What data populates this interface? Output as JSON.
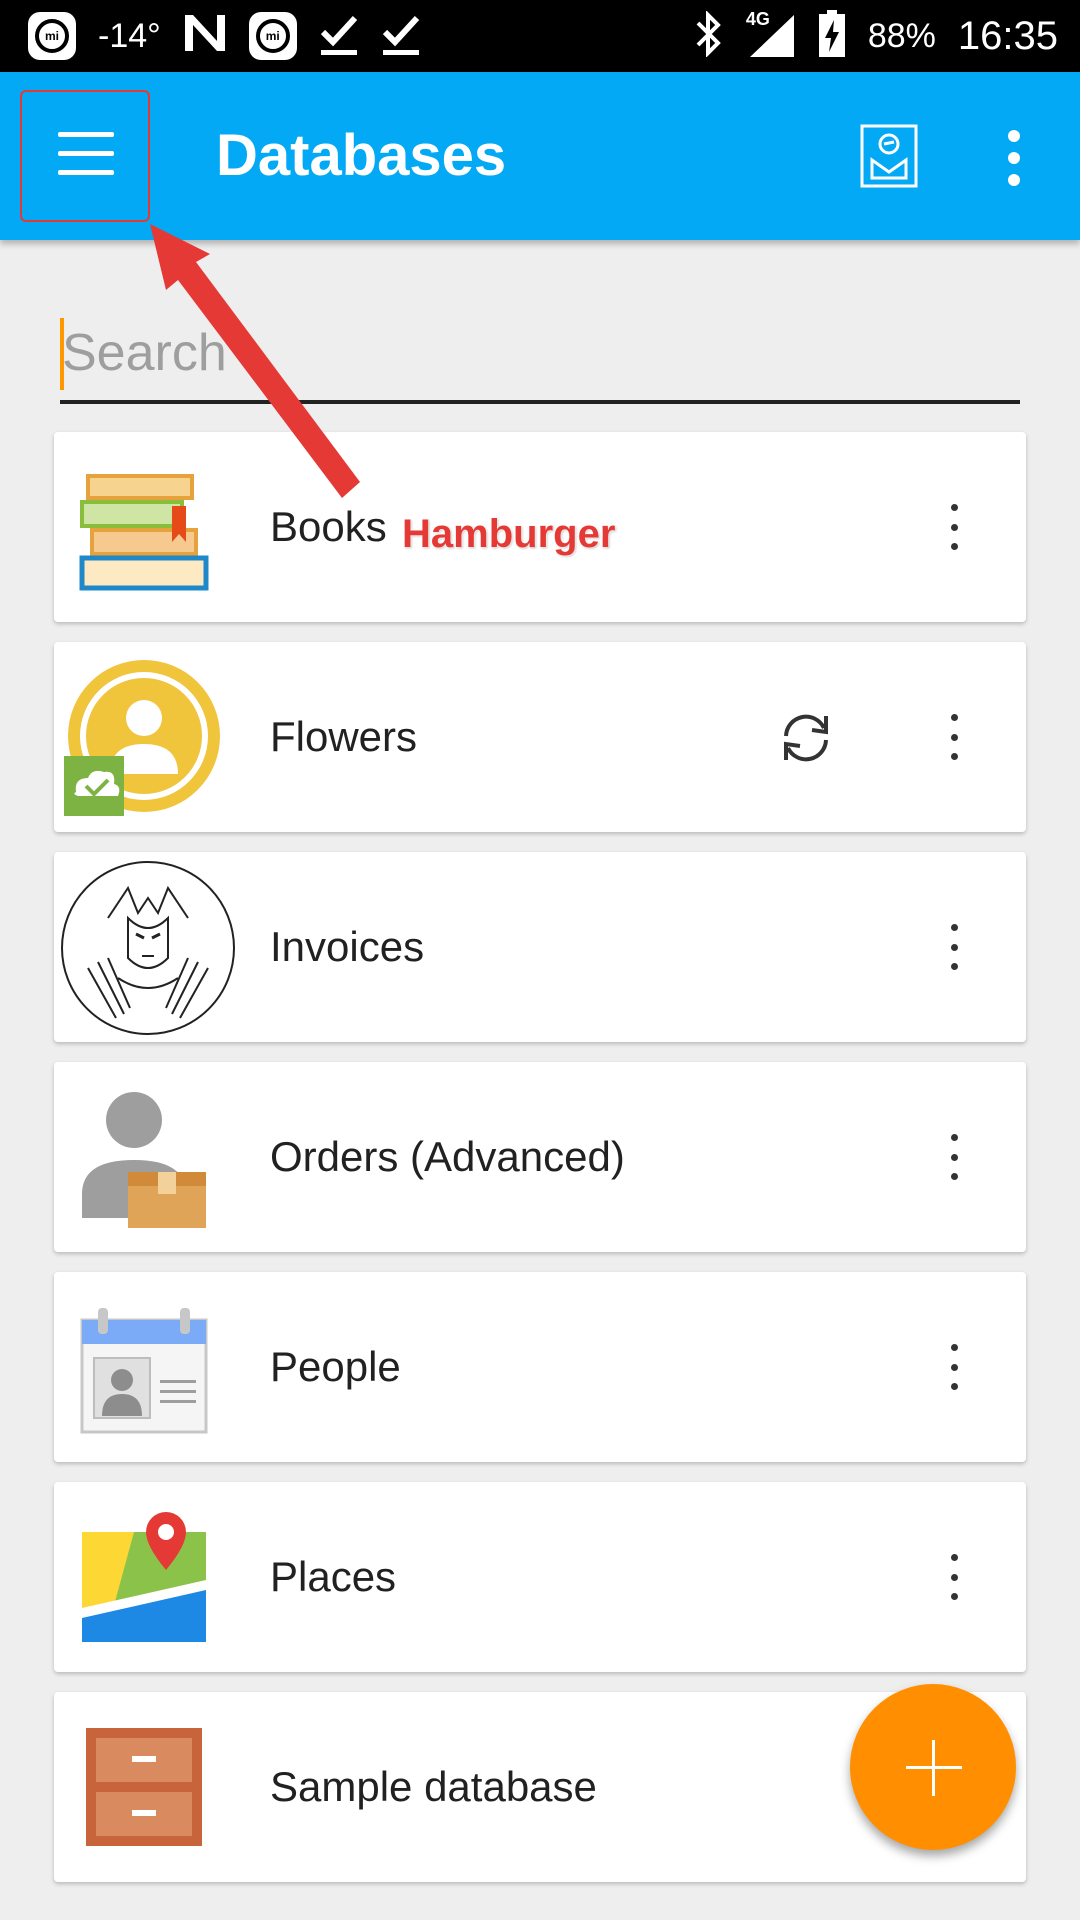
{
  "status_bar": {
    "temperature": "-14°",
    "network": "4G",
    "battery": "88%",
    "time": "16:35"
  },
  "app_bar": {
    "title": "Databases",
    "menu_icon": "hamburger-icon",
    "report_icon": "report-icon",
    "overflow_icon": "more-vert-icon"
  },
  "search": {
    "placeholder": "Search",
    "value": ""
  },
  "databases": [
    {
      "name": "Books",
      "icon": "books-icon",
      "synced": false
    },
    {
      "name": "Flowers",
      "icon": "user-cloud-icon",
      "synced": true
    },
    {
      "name": "Invoices",
      "icon": "wolverine-icon",
      "synced": false
    },
    {
      "name": "Orders (Advanced)",
      "icon": "person-box-icon",
      "synced": false
    },
    {
      "name": "People",
      "icon": "contact-card-icon",
      "synced": false
    },
    {
      "name": "Places",
      "icon": "map-pin-icon",
      "synced": false
    },
    {
      "name": "Sample database",
      "icon": "cabinet-icon",
      "synced": false
    }
  ],
  "annotation": {
    "label": "Hamburger",
    "color": "#e53935"
  },
  "fab": {
    "icon": "plus-icon",
    "color": "#ff8f00"
  },
  "colors": {
    "app_bar": "#03a9f4",
    "accent": "#ff9800"
  }
}
